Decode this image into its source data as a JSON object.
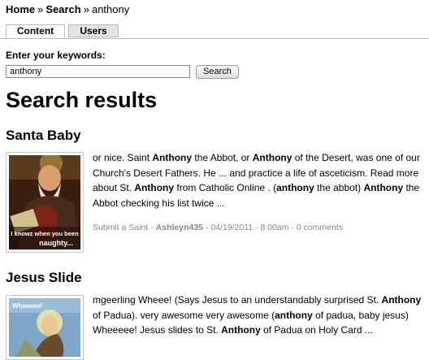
{
  "breadcrumb": {
    "home": "Home",
    "sep1": "»",
    "search": "Search",
    "sep2": "»",
    "current": "anthony"
  },
  "tabs": [
    {
      "label": "Content"
    },
    {
      "label": "Users"
    }
  ],
  "search": {
    "label": "Enter your keywords:",
    "value": "anthony",
    "button": "Search"
  },
  "results_title": "Search results",
  "results": [
    {
      "title": "Santa Baby",
      "thumb_caption_1": "I knowz when you been",
      "thumb_caption_2": "naughty...",
      "snippet": [
        {
          "t": "or nice. Saint "
        },
        {
          "t": "Anthony",
          "b": true
        },
        {
          "t": " the Abbot, or "
        },
        {
          "t": "Anthony",
          "b": true
        },
        {
          "t": " of the Desert, was one of our Church's Desert Fathers. He ... and practice a life of asceticism. Read more about St. "
        },
        {
          "t": "Anthony",
          "b": true
        },
        {
          "t": " from Catholic Online . ("
        },
        {
          "t": "anthony",
          "b": true
        },
        {
          "t": " the abbot) "
        },
        {
          "t": "Anthony",
          "b": true
        },
        {
          "t": " the Abbot checking his list twice ..."
        }
      ],
      "meta": {
        "type": "Submit a Saint",
        "sep": " - ",
        "author": "Ashleyn435",
        "date": " - 04/19/2011 - 8:00am - ",
        "comments": "0 comments"
      }
    },
    {
      "title": "Jesus Slide",
      "thumb_caption_1": "Wheeeee!",
      "snippet": [
        {
          "t": "mgeerling Wheee! (Says Jesus to an understandably surprised St. "
        },
        {
          "t": "Anthony",
          "b": true
        },
        {
          "t": " of Padua). very awesome very awesome ("
        },
        {
          "t": "anthony",
          "b": true
        },
        {
          "t": " of padua, baby jesus) Wheeeee! Jesus slides to St. "
        },
        {
          "t": "Anthony",
          "b": true
        },
        {
          "t": " of Padua on Holy Card ..."
        }
      ]
    }
  ]
}
